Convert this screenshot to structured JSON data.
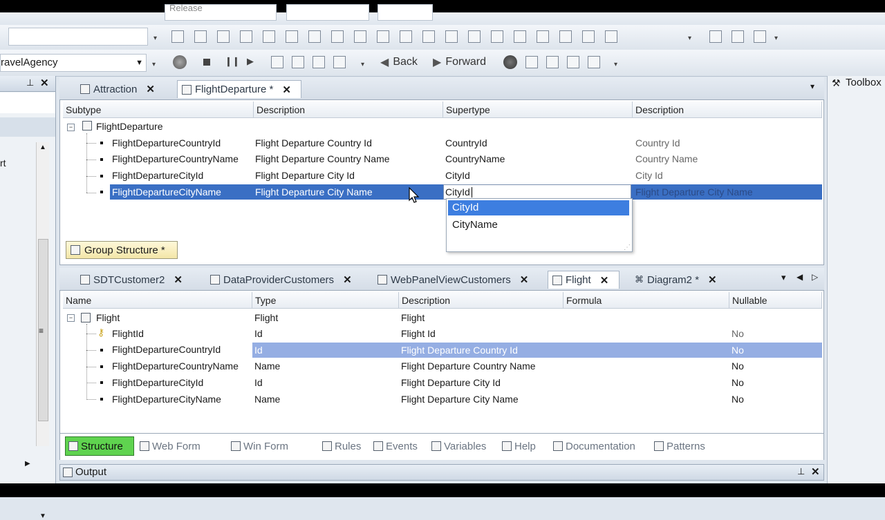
{
  "toolbar": {
    "config_combo": "Release",
    "kb_combo": "ravelAgency",
    "back_label": "Back",
    "forward_label": "Forward"
  },
  "toolbox": {
    "label": "Toolbox"
  },
  "left_panel": {
    "partial_text": "rt"
  },
  "top_tabs": [
    {
      "label": "Attraction"
    },
    {
      "label": "FlightDeparture *"
    }
  ],
  "subtype_grid": {
    "headers": [
      "Subtype",
      "Description",
      "Supertype",
      "Description"
    ],
    "root": "FlightDeparture",
    "rows": [
      {
        "subtype": "FlightDepartureCountryId",
        "description": "Flight Departure Country Id",
        "supertype": "CountryId",
        "sdesc": "Country Id"
      },
      {
        "subtype": "FlightDepartureCountryName",
        "description": "Flight Departure Country Name",
        "supertype": "CountryName",
        "sdesc": "Country Name"
      },
      {
        "subtype": "FlightDepartureCityId",
        "description": "Flight Departure City Id",
        "supertype": "CityId",
        "sdesc": "City Id"
      },
      {
        "subtype": "FlightDepartureCityName",
        "description": "Flight Departure City Name",
        "supertype": "CityId",
        "sdesc": "Flight Departure City Name"
      }
    ],
    "autocomplete": [
      "CityId",
      "CityName"
    ],
    "group_button": "Group Structure *"
  },
  "bottom_tabs": [
    {
      "label": "SDTCustomer2"
    },
    {
      "label": "DataProviderCustomers"
    },
    {
      "label": "WebPanelViewCustomers"
    },
    {
      "label": "Flight"
    },
    {
      "label": "Diagram2 *"
    }
  ],
  "structure_grid": {
    "headers": [
      "Name",
      "Type",
      "Description",
      "Formula",
      "Nullable"
    ],
    "root": {
      "name": "Flight",
      "type": "Flight",
      "description": "Flight"
    },
    "rows": [
      {
        "name": "FlightId",
        "type": "Id",
        "description": "Flight Id",
        "formula": "",
        "nullable": "No"
      },
      {
        "name": "FlightDepartureCountryId",
        "type": "Id",
        "description": "Flight Departure Country Id",
        "formula": "",
        "nullable": "No"
      },
      {
        "name": "FlightDepartureCountryName",
        "type": "Name",
        "description": "Flight Departure Country Name",
        "formula": "",
        "nullable": "No"
      },
      {
        "name": "FlightDepartureCityId",
        "type": "Id",
        "description": "Flight Departure City Id",
        "formula": "",
        "nullable": "No"
      },
      {
        "name": "FlightDepartureCityName",
        "type": "Name",
        "description": "Flight Departure City Name",
        "formula": "",
        "nullable": "No"
      }
    ]
  },
  "editor_tabs": [
    "Structure",
    "Web Form",
    "Win Form",
    "Rules",
    "Events",
    "Variables",
    "Help",
    "Documentation",
    "Patterns"
  ],
  "output": {
    "label": "Output"
  },
  "colors": {
    "selection": "#3a6fc4",
    "row_highlight": "#95aee3",
    "active_tab": "#5fd34f"
  }
}
